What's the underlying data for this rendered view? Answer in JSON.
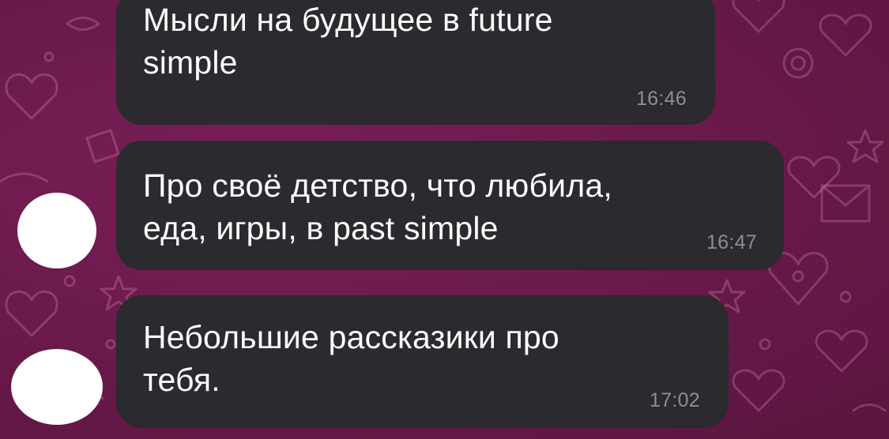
{
  "chat": {
    "messages": [
      {
        "text_line1": "Мысли на будущее в future",
        "text_line2": "simple",
        "time": "16:46"
      },
      {
        "text_line1": "Про своё детство, что любила,",
        "text_line2": "еда, игры, в past simple",
        "time": "16:47"
      },
      {
        "text_line1": "Небольшие рассказики про",
        "text_line2": "тебя.",
        "time": "17:02"
      }
    ]
  },
  "colors": {
    "background": "#6b1a4c",
    "bubble": "#2b2a2e",
    "text": "#ffffff",
    "timestamp": "#8e8d92"
  }
}
